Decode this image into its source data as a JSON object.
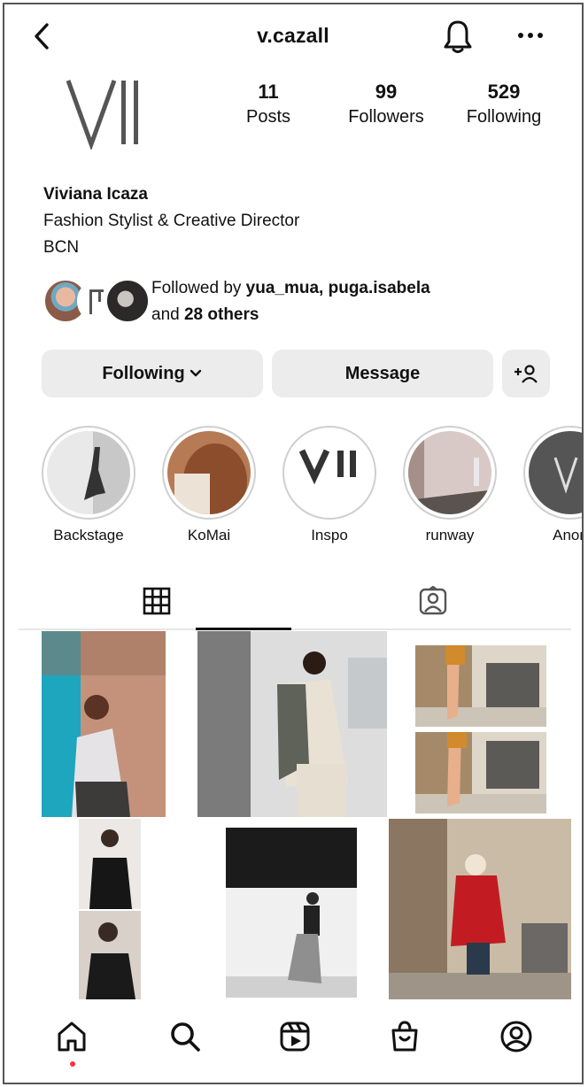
{
  "header": {
    "username": "v.cazall"
  },
  "stats": {
    "posts_count": "11",
    "posts_label": "Posts",
    "followers_count": "99",
    "followers_label": "Followers",
    "following_count": "529",
    "following_label": "Following"
  },
  "bio": {
    "name": "Viviana Icaza",
    "line1": "Fashion Stylist & Creative Director",
    "line2": "BCN"
  },
  "followed_by": {
    "prefix": "Followed by ",
    "users": "yua_mua, puga.isabela",
    "and_text": "and ",
    "others": "28 others"
  },
  "actions": {
    "following_label": "Following",
    "message_label": "Message",
    "add_user_label": "+ person"
  },
  "highlights": [
    {
      "label": "Backstage"
    },
    {
      "label": "KoMai"
    },
    {
      "label": "Inspo"
    },
    {
      "label": "runway"
    },
    {
      "label": "Anon"
    }
  ],
  "tabs": [
    {
      "icon": "grid-icon",
      "active": true
    },
    {
      "icon": "tagged-icon",
      "active": false
    }
  ],
  "nav": [
    {
      "icon": "home-icon",
      "active": true
    },
    {
      "icon": "search-icon"
    },
    {
      "icon": "reels-icon"
    },
    {
      "icon": "shop-icon"
    },
    {
      "icon": "profile-icon"
    }
  ],
  "colors": {
    "button_bg": "#ececec",
    "notification_dot": "#ff3040",
    "text": "#111111"
  }
}
